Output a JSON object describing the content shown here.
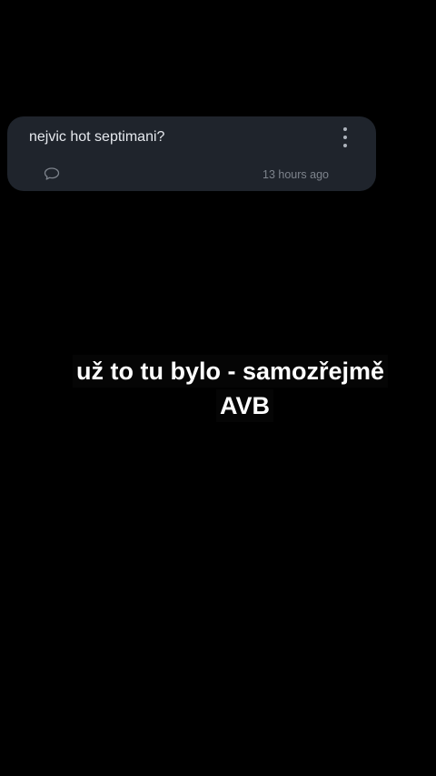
{
  "post": {
    "question": "nejvic hot septimani?",
    "time": "13 hours ago",
    "comment_icon": "comment-icon",
    "menu_icon": "more-vertical-icon"
  },
  "caption": {
    "line1": "už to tu bylo - samozřejmě",
    "line2": "AVB"
  },
  "colors": {
    "background": "#000000",
    "card": "#1f242c",
    "text": "#e6e9ee",
    "muted": "#7d838c"
  }
}
